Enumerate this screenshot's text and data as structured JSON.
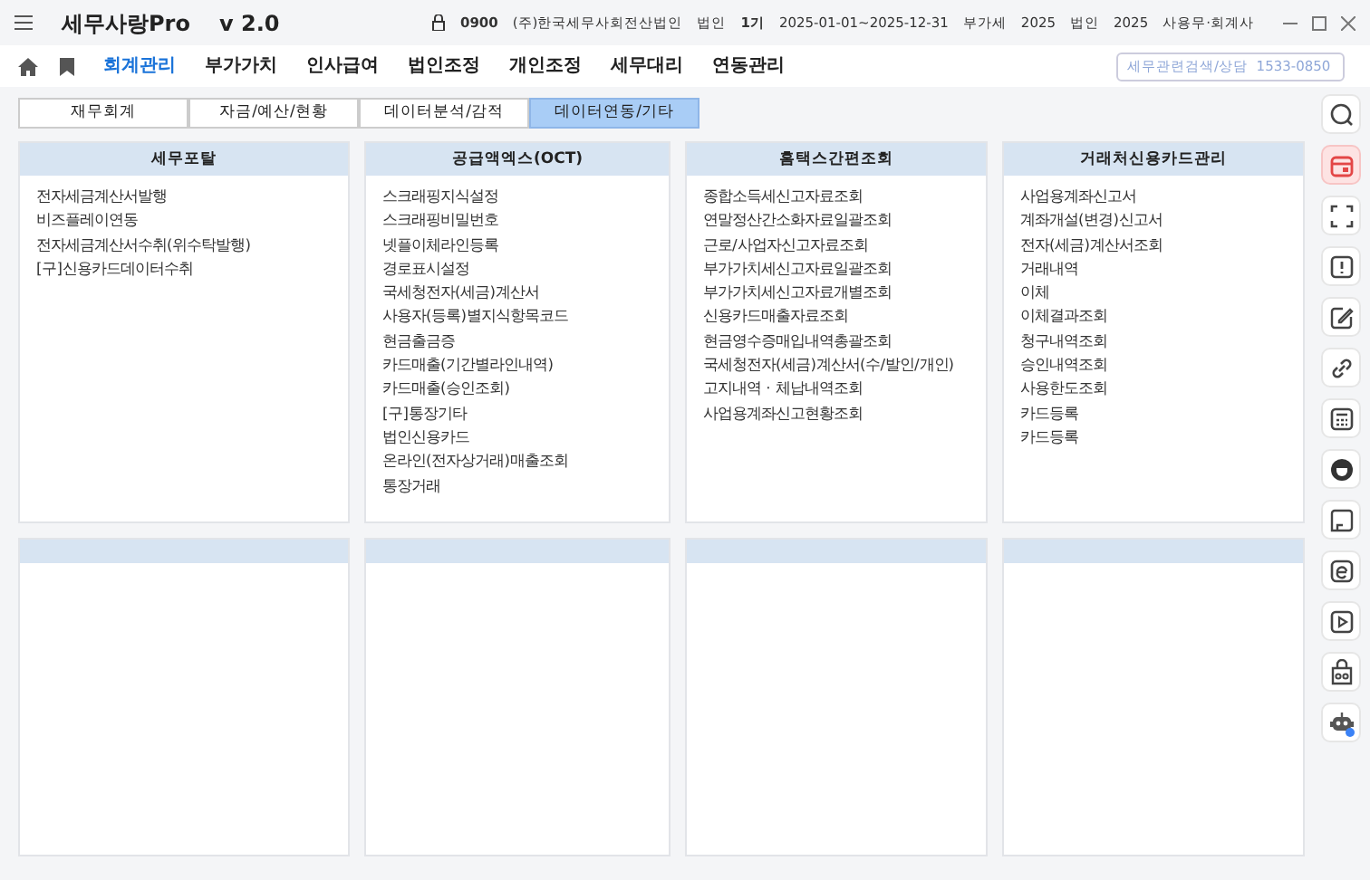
{
  "app": {
    "title": "세무사랑Pro",
    "version": "v 2.0"
  },
  "header_info": [
    {
      "kind": "lock",
      "text": "0900"
    },
    {
      "kind": "text",
      "text": "(주)한국세무사회전산법인"
    },
    {
      "kind": "text",
      "text": "법인"
    },
    {
      "kind": "strong",
      "text": "1기"
    },
    {
      "kind": "text",
      "text": "2025-01-01~2025-12-31"
    },
    {
      "kind": "text",
      "text": "부가세"
    },
    {
      "kind": "text",
      "text": "2025"
    },
    {
      "kind": "text",
      "text": "법인"
    },
    {
      "kind": "text",
      "text": "2025"
    },
    {
      "kind": "text",
      "text": "사용무·회계사"
    }
  ],
  "menu": [
    {
      "label": "회계관리",
      "selected": true
    },
    {
      "label": "부가가치",
      "selected": false
    },
    {
      "label": "인사급여",
      "selected": false
    },
    {
      "label": "법인조정",
      "selected": false
    },
    {
      "label": "개인조정",
      "selected": false
    },
    {
      "label": "세무대리",
      "selected": false
    },
    {
      "label": "연동관리",
      "selected": false
    }
  ],
  "search": {
    "placeholder": "세무관련검색/상담  1533-0850"
  },
  "tabs": [
    {
      "label": "재무회계",
      "selected": false
    },
    {
      "label": "자금/예산/현황",
      "selected": false
    },
    {
      "label": "데이터분석/감적",
      "selected": false
    },
    {
      "label": "데이터연동/기타",
      "selected": true
    }
  ],
  "panels": [
    {
      "title": "세무포탈",
      "items": [
        "전자세금계산서발행",
        "비즈플레이연동",
        "전자세금계산서수취(위수탁발행)",
        "[구]신용카드데이터수취"
      ]
    },
    {
      "title": "공급액엑스(OCT)",
      "items": [
        "스크래핑지식설정",
        "스크래핑비밀번호",
        "넷플이체라인등록",
        "경로표시설정",
        "국세청전자(세금)계산서",
        "사용자(등록)별지식항목코드",
        "현금출금증",
        "카드매출(기간별라인내역)",
        "카드매출(승인조회)",
        "[구]통장기타",
        "법인신용카드",
        "온라인(전자상거래)매출조회",
        "통장거래"
      ]
    },
    {
      "title": "홈택스간편조회",
      "items": [
        "종합소득세신고자료조회",
        "연말정산간소화자료일괄조회",
        "근로/사업자신고자료조회",
        "부가가치세신고자료일괄조회",
        "부가가치세신고자료개별조회",
        "신용카드매출자료조회",
        "현금영수증매입내역총괄조회",
        "국세청전자(세금)계산서(수/발인/개인)",
        "고지내역 · 체납내역조회",
        "사업용계좌신고현황조회"
      ]
    },
    {
      "title": "거래처신용카드관리",
      "items": [
        "사업용계좌신고서",
        "계좌개설(변경)신고서",
        "전자(세금)계산서조회",
        "거래내역",
        "이체",
        "이체결과조회",
        "청구내역조회",
        "승인내역조회",
        "사용한도조회",
        "카드등록",
        "카드등록"
      ]
    }
  ],
  "side_tools": [
    {
      "kind": "search",
      "selected": false
    },
    {
      "kind": "calendar",
      "selected": true
    },
    {
      "kind": "scan",
      "selected": false
    },
    {
      "kind": "alert",
      "selected": false
    },
    {
      "kind": "edit",
      "selected": false
    },
    {
      "kind": "link",
      "selected": false
    },
    {
      "kind": "calculator",
      "selected": false
    },
    {
      "kind": "cup",
      "selected": false
    },
    {
      "kind": "box",
      "selected": false
    },
    {
      "kind": "letter",
      "selected": false
    },
    {
      "kind": "play",
      "selected": false
    },
    {
      "kind": "bag",
      "selected": false
    },
    {
      "kind": "robot",
      "selected": false
    }
  ]
}
